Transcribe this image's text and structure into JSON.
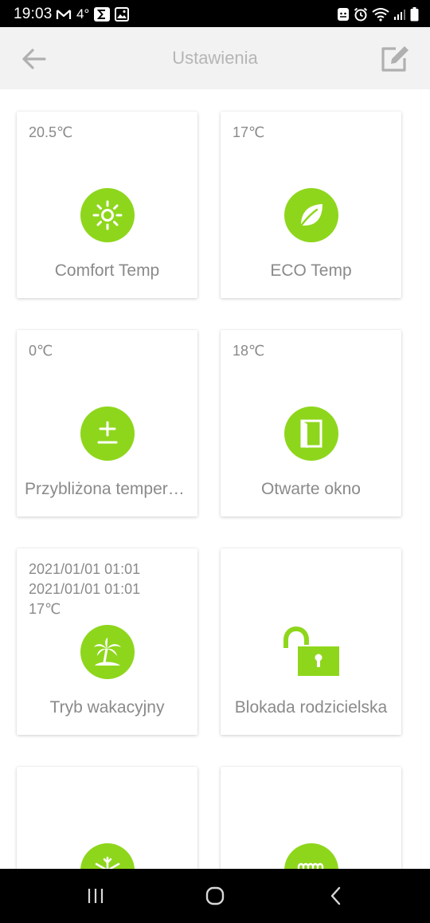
{
  "status_bar": {
    "time": "19:03",
    "temperature": "4°"
  },
  "header": {
    "title": "Ustawienia"
  },
  "cards": [
    {
      "info": "20.5℃",
      "label": "Comfort Temp",
      "icon": "sun-icon"
    },
    {
      "info": "17℃",
      "label": "ECO Temp",
      "icon": "leaf-icon"
    },
    {
      "info": "0℃",
      "label": "Przybliżona temperatura",
      "icon": "plus-minus-icon"
    },
    {
      "info": "18℃",
      "label": "Otwarte okno",
      "icon": "window-icon"
    },
    {
      "info": "2021/01/01 01:01\n2021/01/01 01:01\n17℃",
      "label": "Tryb wakacyjny",
      "icon": "palm-island-icon"
    },
    {
      "info": "",
      "label": "Blokada rodzicielska",
      "icon": "unlock-icon"
    },
    {
      "info": "",
      "label": "",
      "icon": "snowflake-icon"
    },
    {
      "info": "",
      "label": "",
      "icon": "heater-icon"
    }
  ],
  "colors": {
    "accent": "#8ed61c",
    "text_gray": "#8a8a8a",
    "title_gray": "#b5b5b5",
    "header_bg": "#f2f2f2"
  }
}
